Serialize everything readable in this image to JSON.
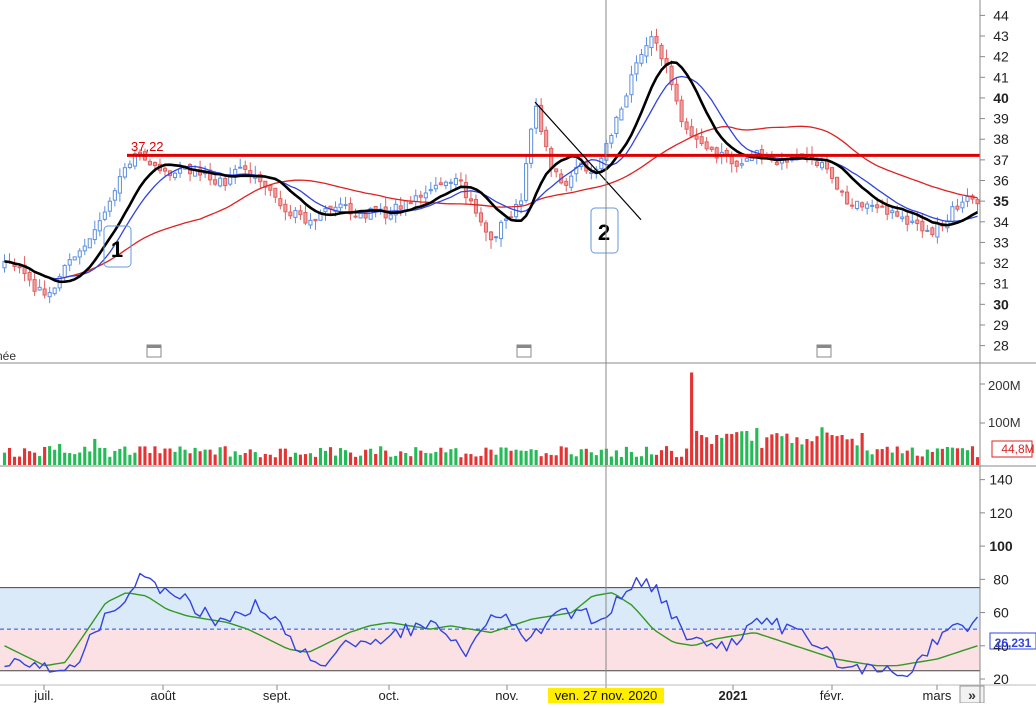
{
  "chart_data": [
    {
      "type": "candlestick",
      "title": "",
      "y_axis": {
        "ticks": [
          28,
          29,
          30,
          31,
          32,
          33,
          34,
          35,
          36,
          37,
          38,
          39,
          40,
          41,
          42,
          43,
          44
        ],
        "bold_ticks": [
          30,
          35,
          40
        ],
        "range": [
          27.4,
          44.6
        ]
      },
      "x_axis": {
        "labels": [
          "juil.",
          "août",
          "sept.",
          "oct.",
          "nov.",
          "2021",
          "févr.",
          "mars"
        ],
        "crosshair_label": "ven. 27 nov. 2020"
      },
      "clipped_left_label": "née",
      "resistance": {
        "value": 37.22,
        "label": "37,22"
      },
      "annotations": [
        "1",
        "2"
      ],
      "key_closes": [
        32.2,
        31.6,
        30.8,
        30.3,
        31.8,
        32.6,
        33.2,
        34.8,
        36.6,
        37.3,
        36.8,
        36.2,
        36.7,
        36.4,
        36.0,
        35.9,
        36.6,
        36.1,
        35.6,
        34.7,
        34.2,
        33.9,
        34.6,
        34.8,
        34.3,
        34.5,
        34.3,
        34.9,
        35.1,
        35.5,
        36.1,
        35.8,
        34.3,
        33.0,
        34.1,
        34.9,
        39.8,
        36.7,
        35.7,
        36.7,
        36.4,
        37.9,
        39.9,
        41.8,
        42.9,
        41.2,
        38.6,
        37.8,
        37.4,
        37.1,
        36.8,
        37.3,
        37.1,
        36.8,
        37.2,
        37.0,
        36.4,
        35.0,
        34.8,
        34.7,
        34.5,
        34.1,
        33.7,
        33.5,
        34.3,
        35.1,
        34.9
      ],
      "moving_averages": [
        "black",
        "blue",
        "red"
      ]
    },
    {
      "type": "bar",
      "panel": "volume",
      "y_axis": {
        "ticks": [
          "100M",
          "200M"
        ]
      },
      "last_value": "44,8M",
      "colors": {
        "up": "#22bb55",
        "down": "#e53333"
      }
    },
    {
      "type": "line",
      "panel": "oscillator",
      "y_axis": {
        "ticks": [
          20,
          40,
          60,
          80,
          100,
          120,
          140
        ],
        "bold_ticks": [
          100
        ],
        "range": [
          17,
          147
        ]
      },
      "levels": {
        "upper": 75,
        "mid": 50,
        "lower": 25
      },
      "last_value": "26,231",
      "oscillator_keys": [
        30,
        28,
        26,
        24,
        35,
        55,
        68,
        80,
        74,
        70,
        62,
        55,
        57,
        64,
        58,
        40,
        28,
        36,
        44,
        42,
        50,
        48,
        58,
        40,
        36,
        60,
        54,
        42,
        55,
        60,
        58,
        56,
        78,
        80,
        66,
        44,
        42,
        40,
        46,
        58,
        50,
        47,
        38,
        30,
        26,
        28,
        22,
        30,
        46,
        50,
        56
      ],
      "signal_keys": [
        40,
        34,
        28,
        30,
        48,
        66,
        72,
        70,
        62,
        58,
        56,
        54,
        50,
        44,
        38,
        36,
        42,
        48,
        52,
        54,
        52,
        50,
        52,
        50,
        48,
        52,
        56,
        58,
        60,
        70,
        72,
        64,
        50,
        42,
        40,
        44,
        46,
        48,
        44,
        40,
        36,
        32,
        30,
        28,
        28,
        30,
        32,
        36,
        40
      ]
    }
  ],
  "colors": {
    "up_candle": "#5b8fe0",
    "down_candle": "#e06060",
    "ma_black": "#000000",
    "ma_blue": "#3344dd",
    "ma_red": "#dd2222",
    "resistance_line": "#dd0000",
    "oscillator_line": "#3344dd",
    "signal_line": "#339922",
    "crosshair_label_bg": "#ffee00"
  },
  "icons": [
    "calendar-icon",
    "calendar-icon",
    "calendar-icon",
    "double-chevron-right-icon"
  ]
}
